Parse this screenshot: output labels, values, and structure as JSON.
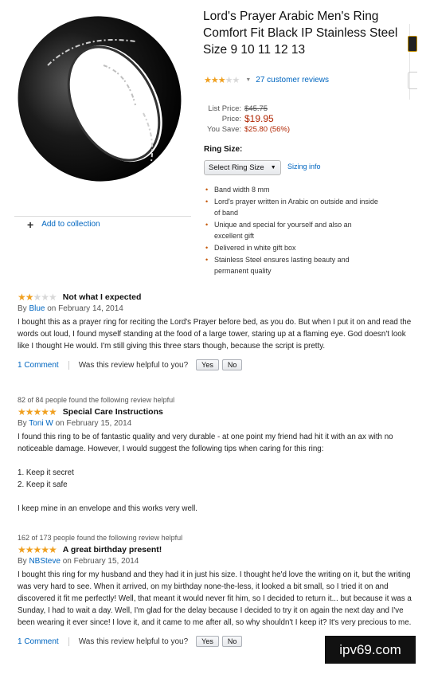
{
  "product": {
    "title": "Lord's Prayer Arabic Men's Ring Comfort Fit Black IP Stainless Steel Size 9 10 11 12 13",
    "rating": 3,
    "reviews_link": "27 customer reviews",
    "list_price_label": "List Price:",
    "list_price": "$45.75",
    "price_label": "Price:",
    "price": "$19.95",
    "save_label": "You Save:",
    "save": "$25.80 (56%)",
    "ring_size_label": "Ring Size:",
    "select_value": "Select Ring Size",
    "sizing_info": "Sizing info",
    "add_to_collection": "Add to collection",
    "bullets": [
      "Band width 8 mm",
      "Lord's prayer written in Arabic on outside and inside of band",
      "Unique and special for yourself and also an excellent gift",
      "Delivered in white gift box",
      "Stainless Steel ensures lasting beauty and permanent quality"
    ]
  },
  "reviews": [
    {
      "rating": 2,
      "title": "Not what I expected",
      "by": "By",
      "author": "Blue",
      "date": "on February 14, 2014",
      "body": [
        "I bought this as a prayer ring for reciting the Lord's Prayer before bed, as you do. But when I put it on and read the words out loud, I found myself standing at the food of a large tower, staring up at a flaming eye. God doesn't look like I thought He would. I'm still giving this three stars though, because the script is pretty."
      ],
      "comment_link": "1 Comment",
      "helpful_question": "Was this review helpful to you?",
      "yes": "Yes",
      "no": "No"
    },
    {
      "helpful_count": "82 of 84 people found the following review helpful",
      "rating": 5,
      "title": "Special Care Instructions",
      "by": "By",
      "author": "Toni W",
      "date": "on February 15, 2014",
      "body": [
        "I found this ring to be of fantastic quality and very durable - at one point my friend had hit it with an ax with no noticeable damage. However, I would suggest the following tips when caring for this ring:",
        "1. Keep it secret",
        "2. Keep it safe",
        "I keep mine in an envelope and this works very well."
      ]
    },
    {
      "helpful_count": "162 of 173 people found the following review helpful",
      "rating": 5,
      "title": "A great birthday present!",
      "by": "By",
      "author": "NBSteve",
      "date": "on February 15, 2014",
      "body": [
        "I bought this ring for my husband and they had it in just his size. I thought he'd love the writing on it, but the writing was very hard to see. When it arrived, on my birthday none-the-less, it looked a bit small, so I tried it on and discovered it fit me perfectly! Well, that meant it would never fit him, so I decided to return it... but because it was a Sunday, I had to wait a day. Well, I'm glad for the delay because I decided to try it on again the next day and I've been wearing it ever since! I love it, and it came to me after all, so why shouldn't I keep it? It's very precious to me."
      ],
      "comment_link": "1 Comment",
      "helpful_question": "Was this review helpful to you?",
      "yes": "Yes",
      "no": "No"
    }
  ],
  "watermark": "ipv69.com",
  "colors": {
    "link": "#0066c0",
    "price": "#b12704",
    "star": "#f0a020"
  }
}
